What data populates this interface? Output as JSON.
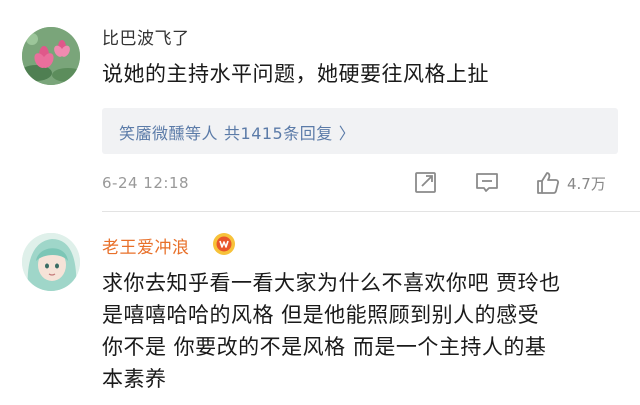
{
  "comments": [
    {
      "username": "比巴波飞了",
      "text": "说她的主持水平问题，她硬要往风格上扯",
      "replies": {
        "names": "笑靥微醺等人",
        "count": "共1415条回复",
        "chevron": "〉"
      },
      "time": "6-24 12:18",
      "likes": "4.7万"
    },
    {
      "username": "老王爱冲浪",
      "text_lines": [
        "求你去知乎看一看大家为什么不喜欢你吧 贾玲也",
        "是嘻嘻哈哈的风格 但是他能照顾到别人的感受",
        "你不是  你要改的不是风格 而是一个主持人的基",
        "本素养"
      ]
    }
  ],
  "colors": {
    "link": "#5b7ba8",
    "vip_username": "#e8702a",
    "meta": "#999999",
    "reply_bg": "#f1f2f4"
  },
  "icons": [
    "share-icon",
    "comment-icon",
    "like-icon",
    "vip-badge-icon"
  ]
}
